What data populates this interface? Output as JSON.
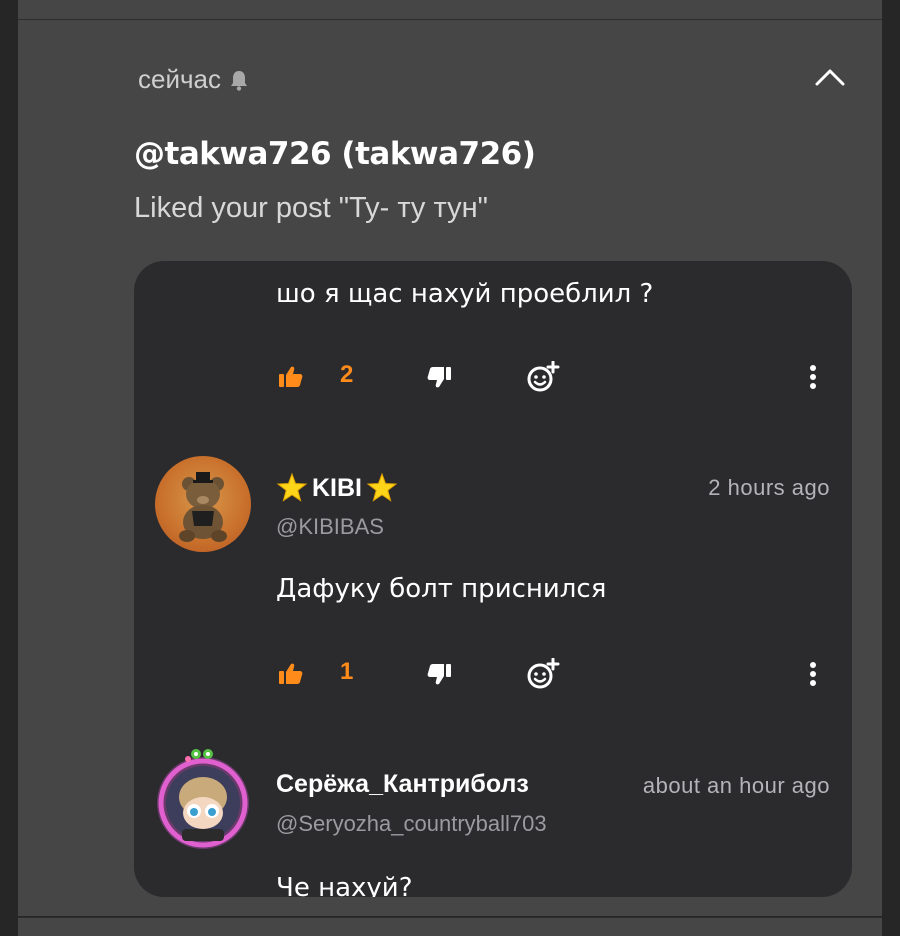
{
  "notification": {
    "time": "сейчас",
    "title": "@takwa726 (takwa726)",
    "message": "Liked your post \"Ту- ту тун\""
  },
  "comments": [
    {
      "text": "шо я щас нахуй проеблил ?",
      "likes": "2"
    },
    {
      "username": "KIBI",
      "handle": "@KIBIBAS",
      "time": "2 hours ago",
      "text": "Дафуку болт приснился",
      "likes": "1"
    },
    {
      "username": "Серёжа_Кантриболз",
      "handle": "@Seryozha_countryball703",
      "time": "about an hour ago",
      "text": "Че нахуй?"
    }
  ],
  "icons": {
    "bell": "bell-icon",
    "collapse": "chevron-up-icon",
    "like": "thumbs-up-icon",
    "dislike": "thumbs-down-icon",
    "react": "add-reaction-icon",
    "more": "more-vertical-icon",
    "star": "star-icon"
  },
  "colors": {
    "accent": "#ff8c1a",
    "card_bg": "#464646",
    "panel_bg": "#2b2a2d",
    "page_bg": "#262626"
  }
}
